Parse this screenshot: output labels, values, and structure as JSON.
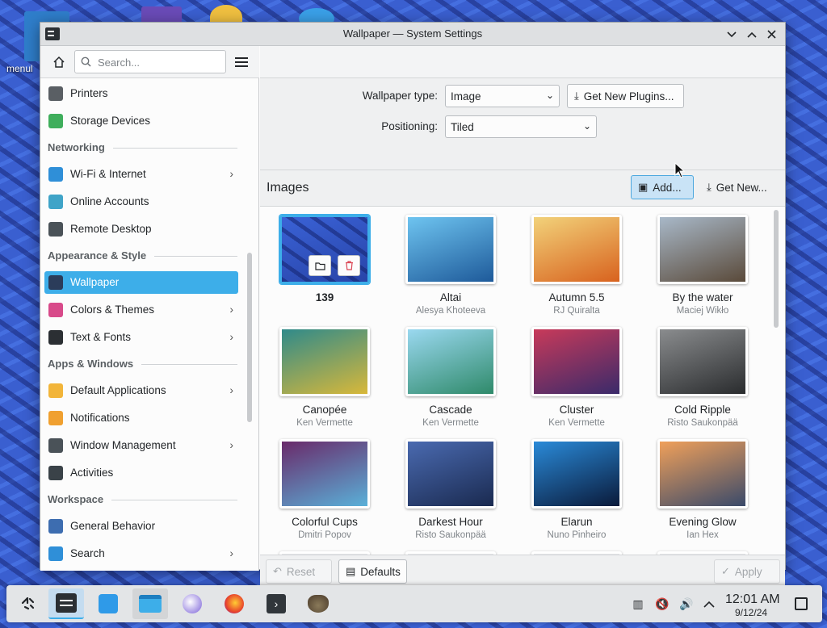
{
  "desktop": {
    "icon_label": "menul"
  },
  "window": {
    "title": "Wallpaper — System Settings"
  },
  "sidebar": {
    "search_placeholder": "Search...",
    "items": [
      {
        "type": "item",
        "label": "Printers",
        "icon": "printer-icon",
        "color": "#5a5f64"
      },
      {
        "type": "item",
        "label": "Storage Devices",
        "icon": "storage-icon",
        "color": "#3fae5c"
      },
      {
        "type": "section",
        "label": "Networking"
      },
      {
        "type": "item",
        "label": "Wi-Fi & Internet",
        "icon": "globe-icon",
        "color": "#2f8fd8",
        "chevron": true
      },
      {
        "type": "item",
        "label": "Online Accounts",
        "icon": "accounts-icon",
        "color": "#3fa4c8"
      },
      {
        "type": "item",
        "label": "Remote Desktop",
        "icon": "remote-desktop-icon",
        "color": "#4a5258"
      },
      {
        "type": "section",
        "label": "Appearance & Style"
      },
      {
        "type": "item",
        "label": "Wallpaper",
        "icon": "wallpaper-icon",
        "color": "#2b3c5a",
        "active": true
      },
      {
        "type": "item",
        "label": "Colors & Themes",
        "icon": "colors-icon",
        "color": "#d84a8a",
        "chevron": true
      },
      {
        "type": "item",
        "label": "Text & Fonts",
        "icon": "fonts-icon",
        "color": "#2b2f33",
        "chevron": true
      },
      {
        "type": "section",
        "label": "Apps & Windows"
      },
      {
        "type": "item",
        "label": "Default Applications",
        "icon": "star-icon",
        "color": "#f2b53a",
        "chevron": true
      },
      {
        "type": "item",
        "label": "Notifications",
        "icon": "bell-icon",
        "color": "#f0a030"
      },
      {
        "type": "item",
        "label": "Window Management",
        "icon": "window-icon",
        "color": "#4a5258",
        "chevron": true
      },
      {
        "type": "item",
        "label": "Activities",
        "icon": "activities-icon",
        "color": "#3a4248"
      },
      {
        "type": "section",
        "label": "Workspace"
      },
      {
        "type": "item",
        "label": "General Behavior",
        "icon": "general-behavior-icon",
        "color": "#3d6db0"
      },
      {
        "type": "item",
        "label": "Search",
        "icon": "search-icon",
        "color": "#2f8fd8",
        "chevron": true
      }
    ]
  },
  "main": {
    "wallpaper_type_label": "Wallpaper type:",
    "wallpaper_type_value": "Image",
    "get_plugins_label": "Get New Plugins...",
    "positioning_label": "Positioning:",
    "positioning_value": "Tiled",
    "images_title": "Images",
    "add_label": "Add...",
    "get_new_label": "Get New...",
    "reset_label": "Reset",
    "defaults_label": "Defaults",
    "apply_label": "Apply",
    "wallpapers": [
      {
        "name": "139",
        "author": "",
        "selected": true,
        "colors": [
          "#3a62d6",
          "#2844a8"
        ]
      },
      {
        "name": "Altai",
        "author": "Alesya Khoteeva",
        "colors": [
          "#6ec4f0",
          "#1e5a9a"
        ]
      },
      {
        "name": "Autumn 5.5",
        "author": "RJ Quiralta",
        "colors": [
          "#f2d27a",
          "#d8621e"
        ]
      },
      {
        "name": "By the water",
        "author": "Maciej Wikło",
        "colors": [
          "#a8b8c8",
          "#5a4a3a"
        ]
      },
      {
        "name": "Canopée",
        "author": "Ken Vermette",
        "colors": [
          "#2f8a8a",
          "#d8b83a"
        ]
      },
      {
        "name": "Cascade",
        "author": "Ken Vermette",
        "colors": [
          "#9ad8f0",
          "#2f8a6a"
        ]
      },
      {
        "name": "Cluster",
        "author": "Ken Vermette",
        "colors": [
          "#c83a5a",
          "#3a2a6a"
        ]
      },
      {
        "name": "Cold Ripple",
        "author": "Risto Saukonpää",
        "colors": [
          "#8a8c8e",
          "#2a2c2e"
        ]
      },
      {
        "name": "Colorful Cups",
        "author": "Dmitri Popov",
        "colors": [
          "#6a2a6a",
          "#5ab0d8"
        ]
      },
      {
        "name": "Darkest Hour",
        "author": "Risto Saukonpää",
        "colors": [
          "#4a6ab0",
          "#1a2a50"
        ]
      },
      {
        "name": "Elarun",
        "author": "Nuno Pinheiro",
        "colors": [
          "#2a8ad8",
          "#0a1a3a"
        ]
      },
      {
        "name": "Evening Glow",
        "author": "Ian Hex",
        "colors": [
          "#f0a05a",
          "#3a4a6a"
        ]
      }
    ]
  },
  "taskbar": {
    "apps": [
      {
        "name": "app-launcher-icon",
        "state": ""
      },
      {
        "name": "system-settings-icon",
        "state": "active"
      },
      {
        "name": "discover-icon",
        "state": ""
      },
      {
        "name": "file-manager-icon",
        "state": "open"
      },
      {
        "name": "kde-app-icon",
        "state": ""
      },
      {
        "name": "firefox-icon",
        "state": ""
      },
      {
        "name": "terminal-icon",
        "state": ""
      },
      {
        "name": "gimp-icon",
        "state": ""
      }
    ],
    "time": "12:01 AM",
    "date": "9/12/24"
  }
}
